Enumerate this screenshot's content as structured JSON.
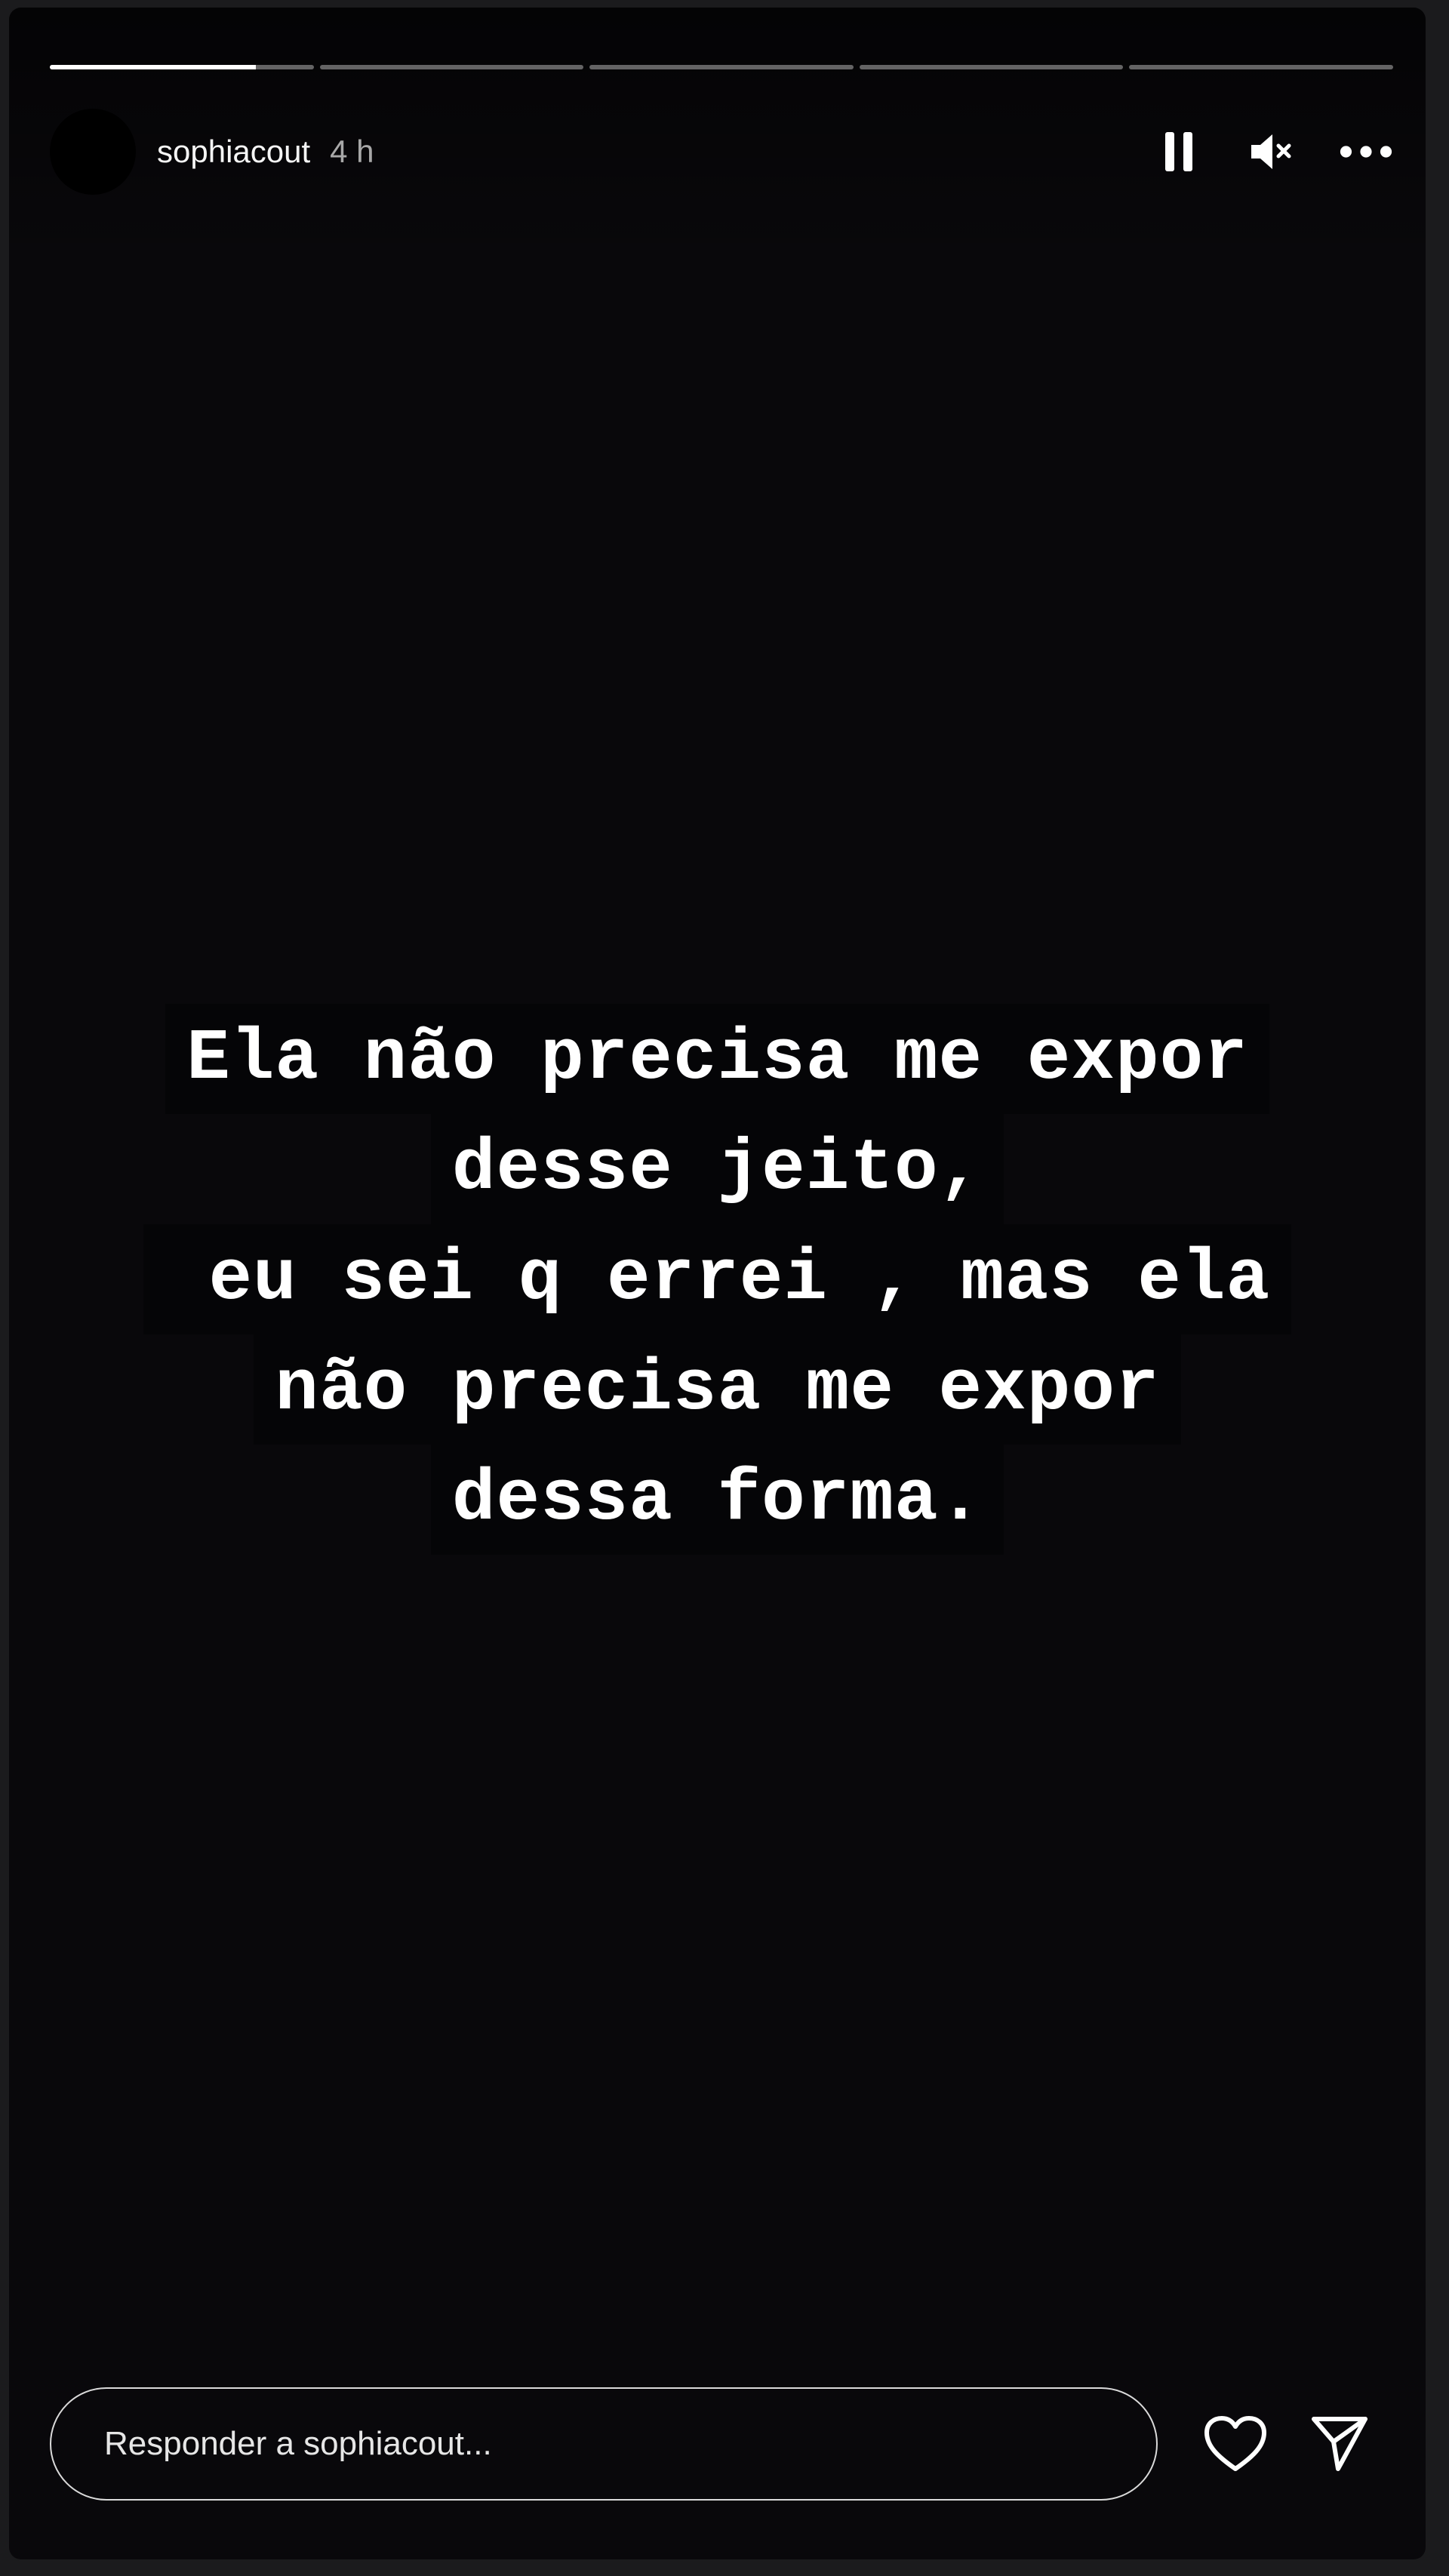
{
  "story": {
    "username": "sophiacout",
    "time": "4 h",
    "segment_count": 5,
    "active_segment": 0,
    "active_segment_progress": 0.78,
    "text_lines": [
      "Ela não precisa me expor",
      "desse jeito,",
      " eu sei q errei , mas ela",
      "não precisa me expor",
      "dessa forma."
    ]
  },
  "header": {
    "icons": [
      "pause-icon",
      "mute-icon",
      "more-icon"
    ]
  },
  "footer": {
    "reply_placeholder": "Responder a sophiacout...",
    "icons": [
      "heart-icon",
      "send-icon"
    ]
  },
  "colors": {
    "background": "#1b1b1d",
    "story_background": "#09080b",
    "text": "#ffffff",
    "text_highlight": "#050507"
  }
}
